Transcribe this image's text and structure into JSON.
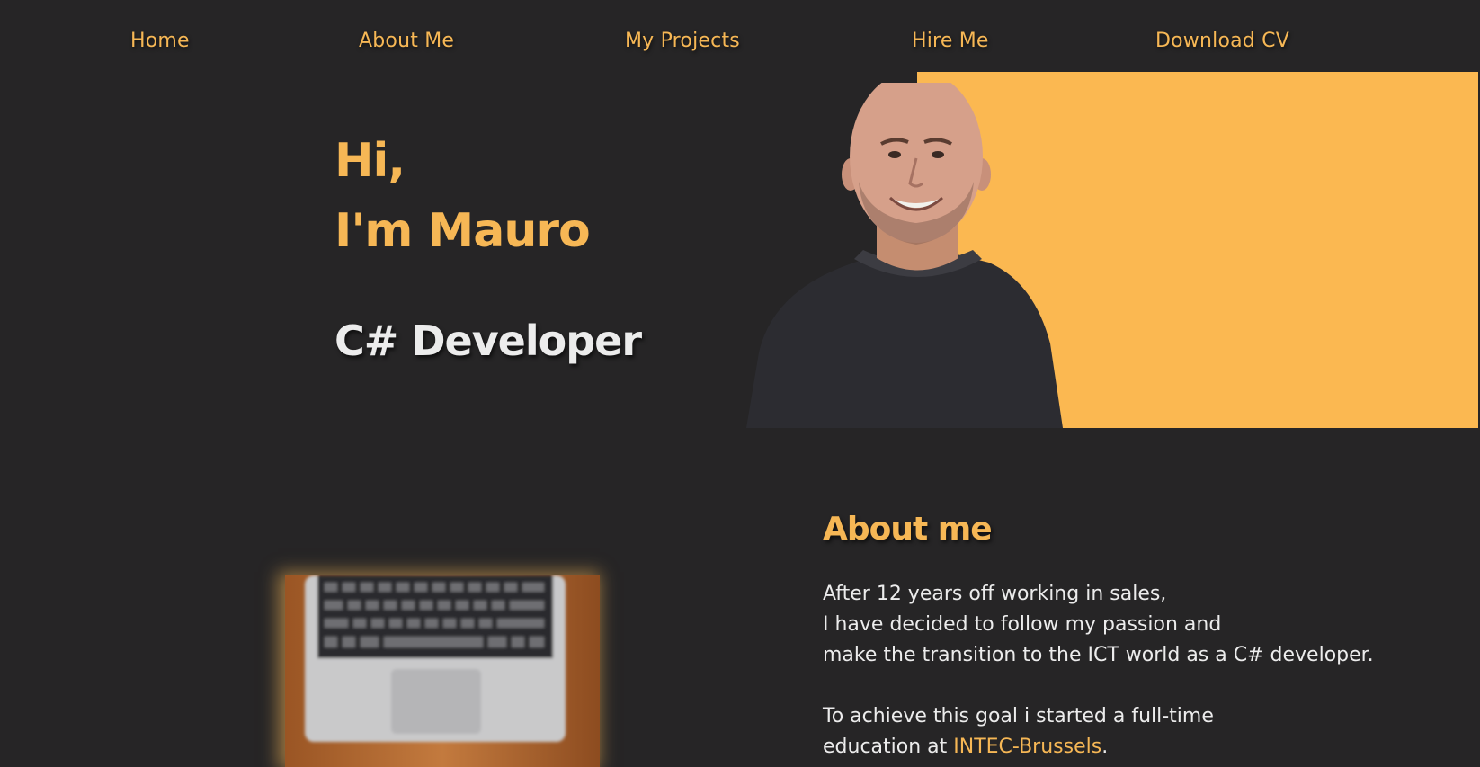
{
  "nav": {
    "items": [
      {
        "label": "Home"
      },
      {
        "label": "About Me"
      },
      {
        "label": "My Projects"
      },
      {
        "label": "Hire Me"
      },
      {
        "label": "Download CV"
      }
    ]
  },
  "hero": {
    "greeting_line1": "Hi,",
    "greeting_line2": "I'm Mauro",
    "role": "C# Developer"
  },
  "about": {
    "title": "About me",
    "lines": [
      "After 12 years off working in sales,",
      "I have decided to follow my passion and",
      "make the transition to the ICT world as a C# developer."
    ],
    "line4": "To achieve this goal i started a full-time",
    "line5_prefix": "education at ",
    "school_link": "INTEC-Brussels",
    "line5_suffix": "."
  },
  "colors": {
    "accent": "#f6b755",
    "background": "#262526",
    "block": "#fbb851",
    "text": "#ececec"
  }
}
